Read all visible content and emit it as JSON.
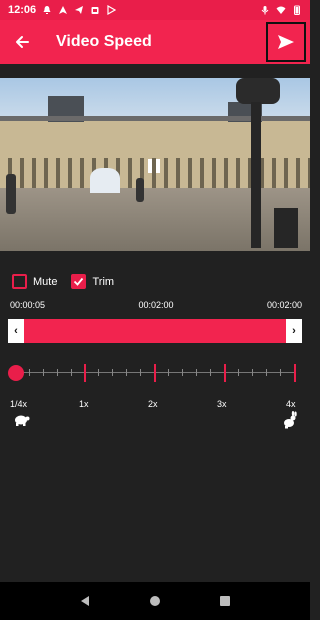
{
  "status_bar": {
    "time": "12:06",
    "notifications": [
      "bell-icon",
      "navigation-icon",
      "telegram-icon",
      "calendar-icon",
      "play-store-icon"
    ],
    "system": [
      "mic-icon",
      "wifi-icon",
      "battery-icon"
    ]
  },
  "app_bar": {
    "title": "Video Speed",
    "back_icon": "arrow-left-icon",
    "send_icon": "send-icon"
  },
  "video": {
    "state_icon": "pause-icon"
  },
  "options": {
    "mute": {
      "label": "Mute",
      "checked": false
    },
    "trim": {
      "label": "Trim",
      "checked": true
    }
  },
  "timeline": {
    "start": "00:00:05",
    "duration": "00:02:00",
    "end": "00:02:00",
    "left_handle": "‹",
    "right_handle": "›"
  },
  "speed": {
    "labels": [
      "1/4x",
      "1x",
      "2x",
      "3x",
      "4x"
    ],
    "slow_icon": "turtle-icon",
    "fast_icon": "rabbit-icon"
  },
  "colors": {
    "accent": "#f2244f",
    "background": "#212121"
  },
  "nav_bar": {
    "buttons": [
      "back-triangle-icon",
      "home-circle-icon",
      "recents-square-icon"
    ]
  }
}
